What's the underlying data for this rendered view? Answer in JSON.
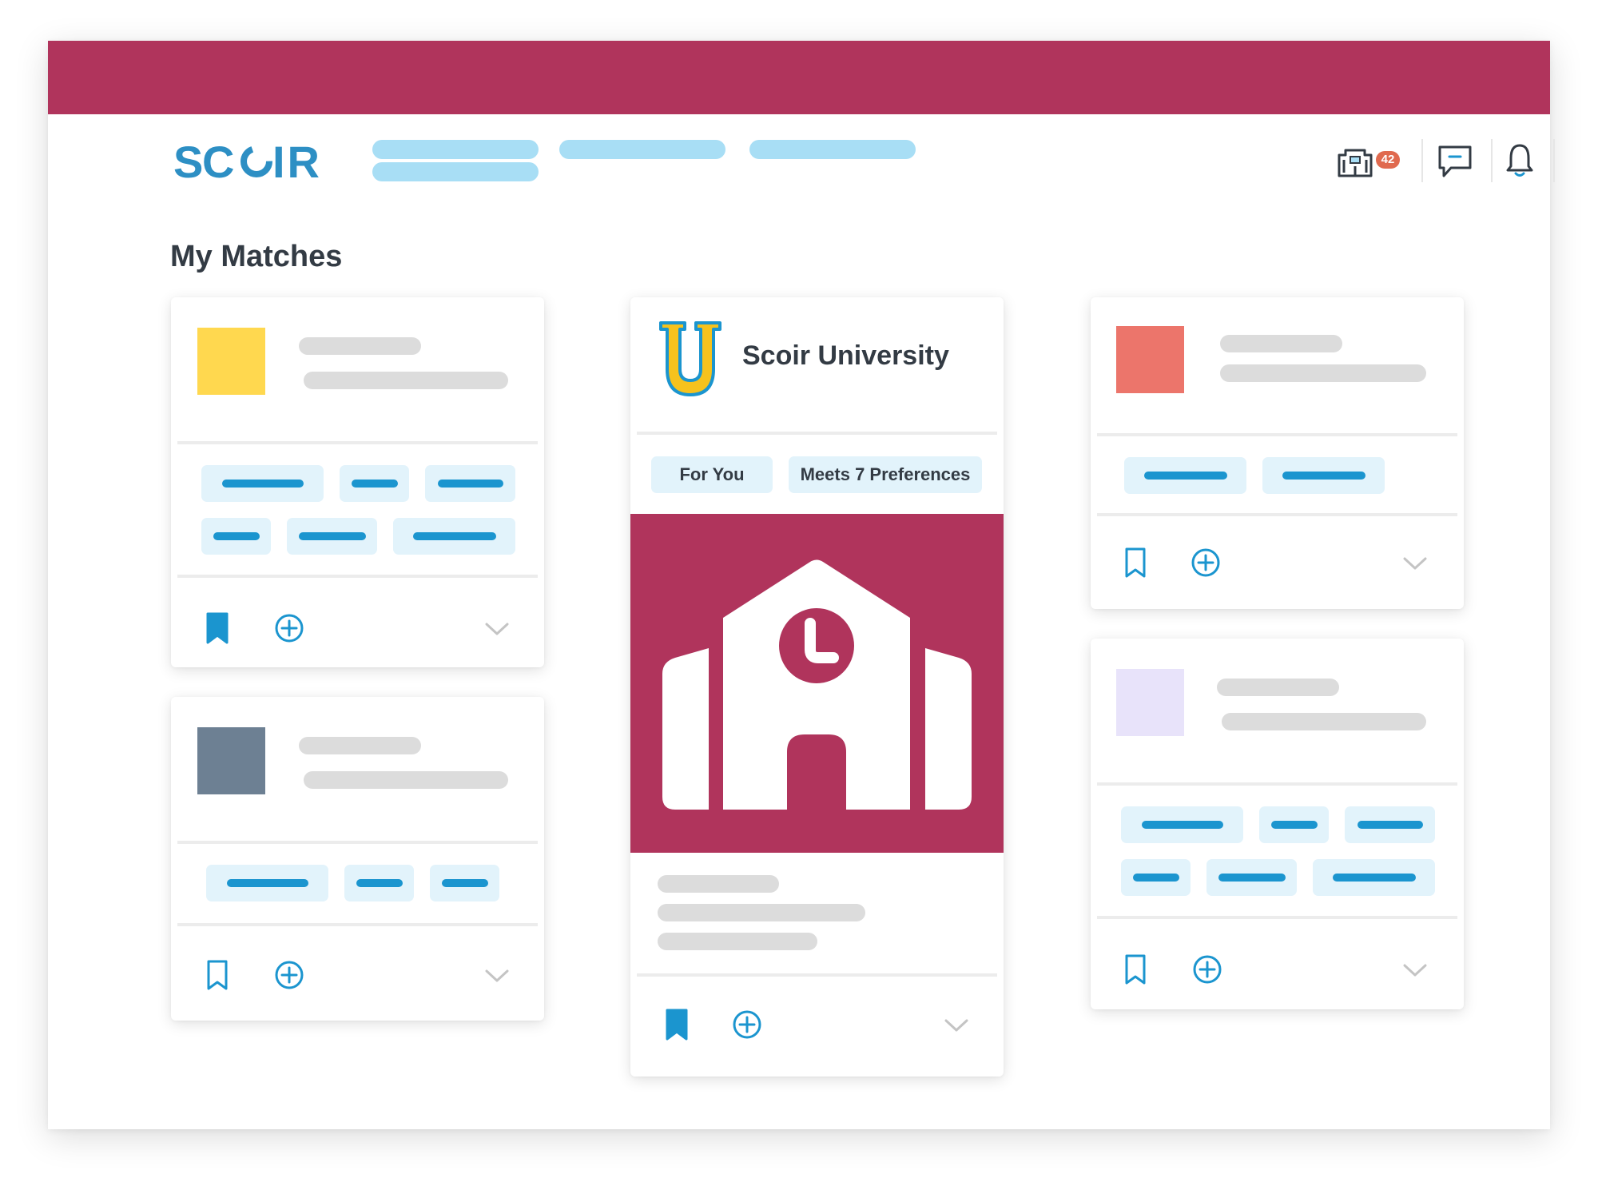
{
  "app": {
    "brand": "SCOIR",
    "brand_color": "#b0345c",
    "accent_color": "#1b95cf",
    "logo_color": "#2d8fc4"
  },
  "header": {
    "nav_items": [
      "",
      "",
      ""
    ],
    "icons": [
      "college-building-icon",
      "chat-icon",
      "bell-icon"
    ],
    "college_count": "42"
  },
  "page": {
    "title": "My Matches"
  },
  "featured_card": {
    "name": "Scoir University",
    "tags": [
      "For You",
      "Meets 7 Preferences"
    ],
    "hero_icon": "school-building-icon",
    "bookmarked": true
  },
  "cards": [
    {
      "thumb_color": "#ffd84f",
      "bookmarked": true
    },
    {
      "thumb_color": "#6d8093",
      "bookmarked": false
    },
    {
      "thumb_color": "#ec756b",
      "bookmarked": false
    },
    {
      "thumb_color": "#e8e3fa",
      "bookmarked": false
    }
  ]
}
